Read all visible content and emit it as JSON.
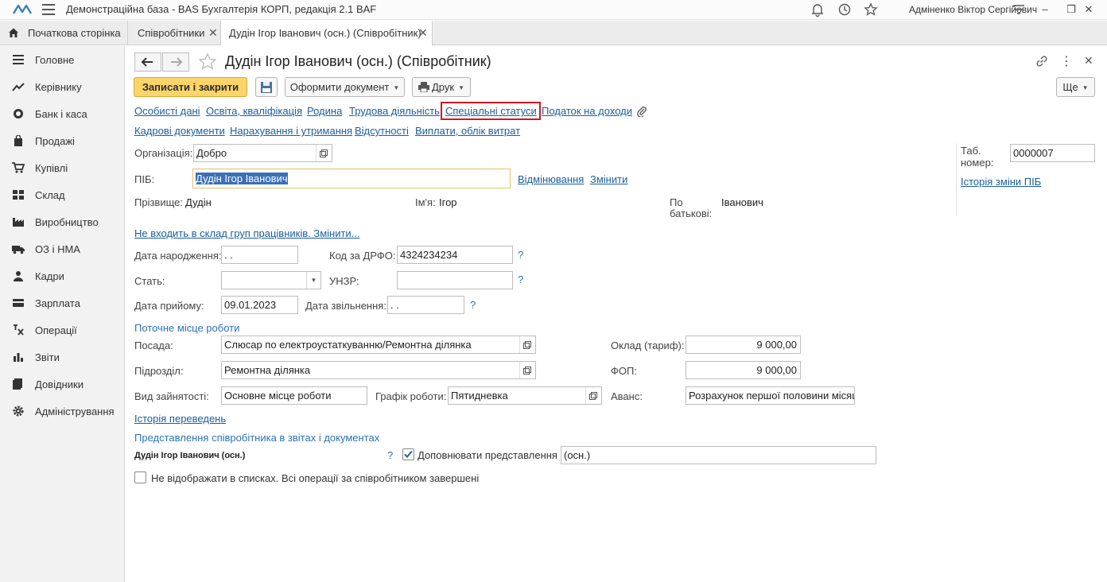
{
  "app": {
    "title": "Демонстраційна база - BAS Бухгалтерія КОРП, редакція 2.1 BAF",
    "user": "Адміненко Віктор Сергійович"
  },
  "tabs": [
    {
      "label": "Початкова сторінка"
    },
    {
      "label": "Співробітники"
    },
    {
      "label": "Дудін Ігор Іванович (осн.) (Співробітник)"
    }
  ],
  "sidebar": {
    "items": [
      {
        "label": "Головне",
        "icon": "menu-lines-icon"
      },
      {
        "label": "Керівнику",
        "icon": "trend-icon"
      },
      {
        "label": "Банк і каса",
        "icon": "coins-icon"
      },
      {
        "label": "Продажі",
        "icon": "bag-icon"
      },
      {
        "label": "Купівлі",
        "icon": "cart-icon"
      },
      {
        "label": "Склад",
        "icon": "grid-icon"
      },
      {
        "label": "Виробництво",
        "icon": "factory-icon"
      },
      {
        "label": "ОЗ і НМА",
        "icon": "truck-icon"
      },
      {
        "label": "Кадри",
        "icon": "person-icon"
      },
      {
        "label": "Зарплата",
        "icon": "wallet-icon"
      },
      {
        "label": "Операції",
        "icon": "operations-icon"
      },
      {
        "label": "Звіти",
        "icon": "bar-chart-icon"
      },
      {
        "label": "Довідники",
        "icon": "books-icon"
      },
      {
        "label": "Адміністрування",
        "icon": "gear-icon"
      }
    ]
  },
  "form": {
    "title": "Дудін Ігор Іванович (осн.) (Співробітник)",
    "toolbar": {
      "save_close": "Записати і закрити",
      "create_doc": "Оформити документ",
      "print": "Друк",
      "more": "Ще"
    },
    "links_row1": [
      "Особисті дані",
      "Освіта, кваліфікація",
      "Родина",
      "Трудова діяльність",
      "Спеціальні статуси",
      "Податок на доходи"
    ],
    "links_row2": [
      "Кадрові документи",
      "Нарахування і утримання",
      "Відсутності",
      "Виплати, облік витрат"
    ],
    "organization": {
      "label": "Організація:",
      "value": "Добро"
    },
    "tab_number": {
      "label1": "Таб.",
      "label2": "номер:",
      "value": "0000007"
    },
    "history_fio": "Історія зміни ПІБ",
    "fio": {
      "label": "ПІБ:",
      "value": "Дудін Ігор Іванович",
      "declension": "Відмінювання",
      "change": "Змінити"
    },
    "surname": {
      "label": "Прізвище:",
      "value": "Дудін"
    },
    "name": {
      "label": "Ім'я:",
      "value": "Ігор"
    },
    "patronymic": {
      "label1": "По",
      "label2": "батькові:",
      "value": "Іванович"
    },
    "groups_link": "Не входить в склад груп працівників. Змінити...",
    "birth_date": {
      "label": "Дата народження:",
      "value": " .  ."
    },
    "drfo": {
      "label": "Код за ДРФО:",
      "value": "4324234234"
    },
    "gender": {
      "label": "Стать:",
      "value": ""
    },
    "unzr": {
      "label": "УНЗР:",
      "value": ""
    },
    "hire_date": {
      "label": "Дата прийому:",
      "value": "09.01.2023"
    },
    "dismissal_date": {
      "label": "Дата звільнення:",
      "value": " .  ."
    },
    "question": "?",
    "workplace_section": "Поточне місце роботи",
    "position": {
      "label": "Посада:",
      "value": "Слюсар по електроустаткуванню/Ремонтна ділянка"
    },
    "department": {
      "label": "Підрозділ:",
      "value": "Ремонтна ділянка"
    },
    "employment_type": {
      "label": "Вид зайнятості:",
      "value": "Основне місце роботи"
    },
    "schedule": {
      "label": "Графік роботи:",
      "value": "Пятидневка"
    },
    "salary": {
      "label": "Оклад (тариф):",
      "value": "9 000,00"
    },
    "fop": {
      "label": "ФОП:",
      "value": "9 000,00"
    },
    "advance": {
      "label": "Аванс:",
      "value": "Розрахунок першої половини місяця"
    },
    "history_transfers": "Історія переведень",
    "representation_section": "Представлення співробітника в звітах і документах",
    "representation_name": "Дудін Ігор Іванович (осн.)",
    "supplement": {
      "label": "Доповнювати представлення",
      "value": "(осн.)"
    },
    "hide_label": "Не відображати в списках. Всі операції за співробітником завершені"
  },
  "colors": {
    "accent": "#fbd46a",
    "link": "#1a5e9e",
    "highlight": "#d0181f"
  }
}
